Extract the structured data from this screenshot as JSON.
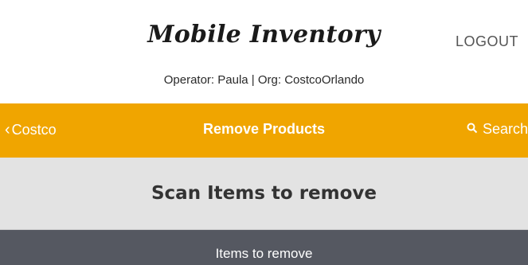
{
  "header": {
    "app_title": "Mobile Inventory",
    "operator_line": "Operator: Paula | Org: CostcoOrlando",
    "logout_label": "LOGOUT"
  },
  "navbar": {
    "back_label": "Costco",
    "title": "Remove Products",
    "search_label": "Search",
    "color": "#f0a500"
  },
  "scan": {
    "title": "Scan Items to remove"
  },
  "items": {
    "title": "Items to remove"
  }
}
